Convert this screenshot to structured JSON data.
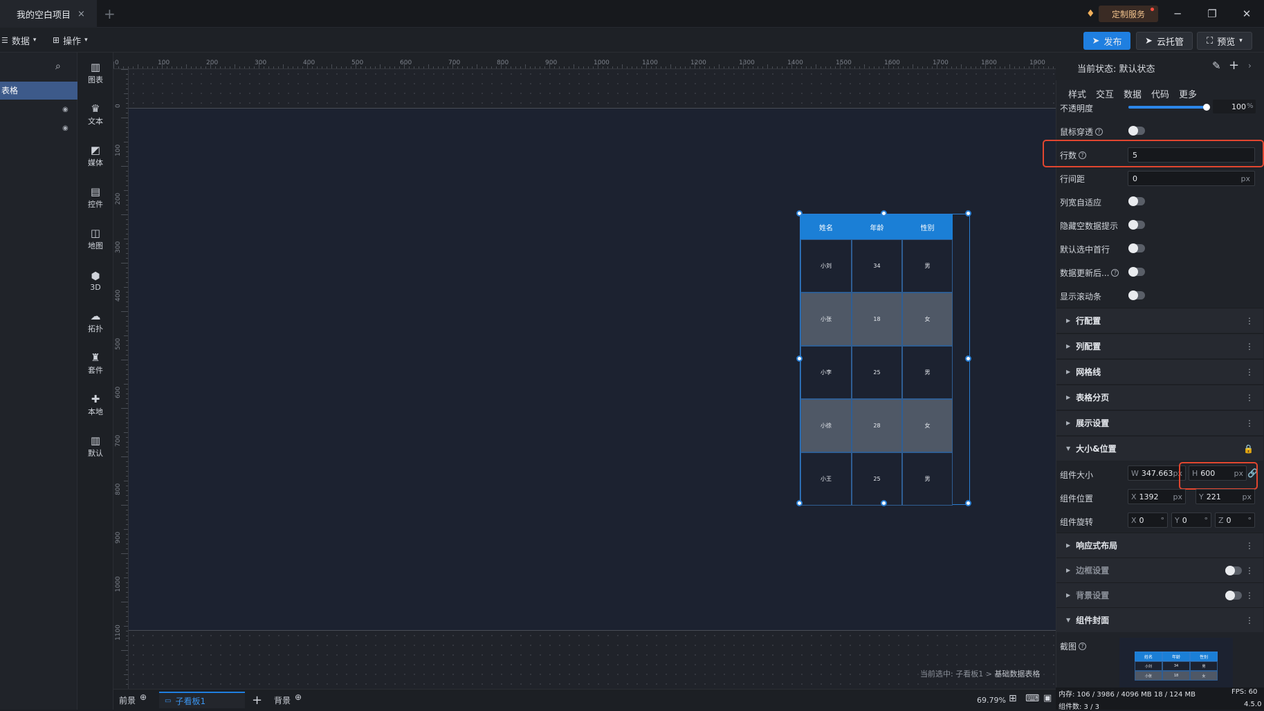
{
  "titlebar": {
    "tab_title": "我的空白项目",
    "close": "×",
    "add": "+",
    "custom_service": "定制服务",
    "min": "─",
    "restore": "❐",
    "close_win": "✕"
  },
  "toolbar": {
    "data_menu": "数据",
    "ops_menu": "操作",
    "publish": "发布",
    "cloud": "云托管",
    "preview": "预览"
  },
  "layers": {
    "selected": "表格"
  },
  "strip": [
    {
      "label": "图表",
      "icon": "bar-chart-icon"
    },
    {
      "label": "文本",
      "icon": "text-icon"
    },
    {
      "label": "媒体",
      "icon": "media-icon"
    },
    {
      "label": "控件",
      "icon": "control-icon"
    },
    {
      "label": "地图",
      "icon": "map-icon"
    },
    {
      "label": "3D",
      "icon": "cube-icon"
    },
    {
      "label": "拓扑",
      "icon": "topology-icon"
    },
    {
      "label": "套件",
      "icon": "kit-icon"
    },
    {
      "label": "本地",
      "icon": "puzzle-icon"
    },
    {
      "label": "默认",
      "icon": "default-chart-icon"
    }
  ],
  "ruler_h": [
    "0",
    "100",
    "200",
    "300",
    "400",
    "500",
    "600",
    "700",
    "800",
    "900",
    "1000",
    "1100",
    "1200",
    "1300",
    "1400",
    "1500",
    "1600",
    "1700",
    "1800",
    "1900"
  ],
  "ruler_v": [
    "0",
    "100",
    "200",
    "300",
    "400",
    "500",
    "600",
    "700",
    "800",
    "900",
    "1000",
    "1100"
  ],
  "table": {
    "headers": [
      "姓名",
      "年龄",
      "性别"
    ],
    "rows": [
      [
        "小刘",
        "34",
        "男"
      ],
      [
        "小张",
        "18",
        "女"
      ],
      [
        "小李",
        "25",
        "男"
      ],
      [
        "小徐",
        "28",
        "女"
      ],
      [
        "小王",
        "25",
        "男"
      ]
    ],
    "header_color": "#1b7fd6",
    "odd_row_color": "#1c2230",
    "even_row_color": "#4f5866"
  },
  "crumb": {
    "prefix": "当前选中: 子看板1 > ",
    "current": "基础数据表格"
  },
  "bottom": {
    "front": "前景",
    "board": "子看板1",
    "add": "+",
    "back": "背景",
    "zoom": "69.79%"
  },
  "panel": {
    "state_label": "当前状态: 默认状态",
    "tabs": [
      "样式",
      "交互",
      "数据",
      "代码",
      "更多"
    ],
    "opacity_label": "不透明度",
    "opacity_value": "100",
    "opacity_unit": "%",
    "opacity_fraction": 1.0,
    "mouse_through": "鼠标穿透",
    "rows_label": "行数",
    "rows_value": "5",
    "row_gap_label": "行间距",
    "row_gap_value": "0",
    "px": "px",
    "col_adapt": "列宽自适应",
    "hide_empty": "隐藏空数据提示",
    "select_first": "默认选中首行",
    "after_update": "数据更新后...",
    "show_scroll": "显示滚动条",
    "sections": [
      "行配置",
      "列配置",
      "网格线",
      "表格分页",
      "展示设置"
    ],
    "size_section": "大小&位置",
    "size_label": "组件大小",
    "w_label": "W",
    "w_value": "347.663",
    "h_label": "H",
    "h_value": "600",
    "pos_label": "组件位置",
    "x_label": "X",
    "x_value": "1392",
    "y_label": "Y",
    "y_value": "221",
    "rot_label": "组件旋转",
    "rx": "0",
    "ry": "0",
    "rz": "0",
    "z_label": "Z",
    "deg": "°",
    "responsive": "响应式布局",
    "border": "边框设置",
    "background": "背景设置",
    "cover": "组件封面",
    "screenshot": "截图",
    "more": "⋮"
  },
  "status": {
    "mem": "内存: 106 / 3986 / 4096 MB  18 / 124 MB",
    "fps": "FPS: 60",
    "count": "组件数: 3 / 3",
    "version": "4.5.0"
  }
}
